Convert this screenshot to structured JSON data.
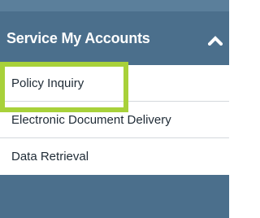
{
  "header": {
    "title": "Service My Accounts",
    "toggle_icon": "chevron-up-icon"
  },
  "menu": {
    "items": [
      {
        "label": "Policy Inquiry",
        "highlighted": true
      },
      {
        "label": "Electronic Document Delivery",
        "highlighted": false
      },
      {
        "label": "Data Retrieval",
        "highlighted": false
      }
    ]
  },
  "colors": {
    "header_bg": "#4b6f8c",
    "highlight_border": "#a8d13a",
    "menu_bg": "#ffffff",
    "text": "#1f2b36"
  }
}
